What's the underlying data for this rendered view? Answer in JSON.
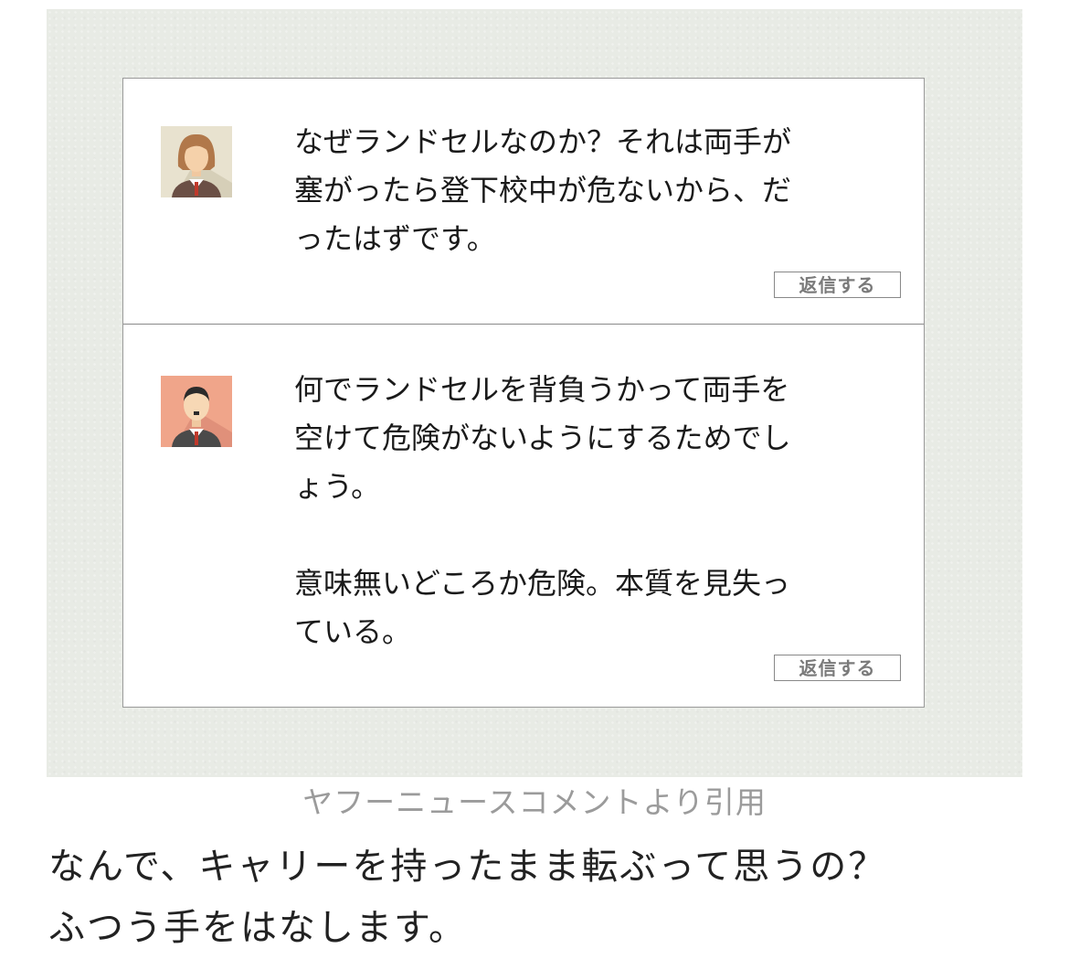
{
  "comments": [
    {
      "avatar": "woman-avatar-icon",
      "paragraphs": [
        "なぜランドセルなのか？それは両手が塞がったら登下校中が危ないから、だったはずです。"
      ],
      "reply_label": "返信する"
    },
    {
      "avatar": "man-avatar-icon",
      "paragraphs": [
        "何でランドセルを背負うかって両手を空けて危険がないようにするためでしょう。",
        "意味無いどころか危険。本質を見失っている。"
      ],
      "reply_label": "返信する"
    }
  ],
  "caption": "ヤフーニュースコメントより引用",
  "body_lines": [
    "なんで、キャリーを持ったまま転ぶって思うの？",
    "ふつう手をはなします。"
  ],
  "colors": {
    "panel_bg": "#e8ebe5",
    "caption_text": "#9b9b9b"
  }
}
